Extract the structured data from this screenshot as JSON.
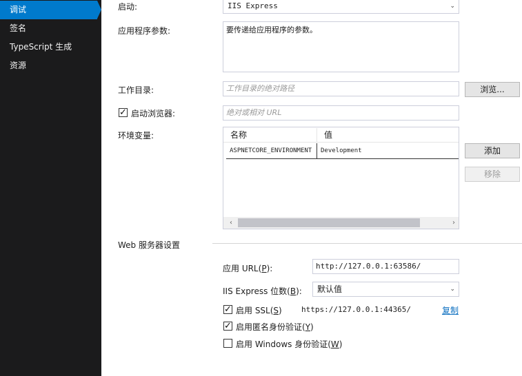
{
  "sidebar": {
    "items": [
      {
        "label": "调试"
      },
      {
        "label": "签名"
      },
      {
        "label": "TypeScript 生成"
      },
      {
        "label": "资源"
      }
    ]
  },
  "form": {
    "launch": {
      "label": "启动:",
      "value": "IIS Express"
    },
    "app_args": {
      "label": "应用程序参数:",
      "placeholder": "要传递给应用程序的参数。"
    },
    "working_dir": {
      "label": "工作目录:",
      "placeholder": "工作目录的绝对路径",
      "browse_label": "浏览..."
    },
    "launch_browser": {
      "label": "启动浏览器:",
      "checked": true,
      "placeholder": "绝对或相对 URL"
    },
    "env_vars": {
      "label": "环境变量:",
      "columns": [
        "名称",
        "值"
      ],
      "rows": [
        {
          "name": "ASPNETCORE_ENVIRONMENT",
          "value": "Development"
        }
      ],
      "add_label": "添加",
      "remove_label": "移除"
    }
  },
  "web_server": {
    "section_title": "Web 服务器设置",
    "app_url": {
      "label_prefix": "应用 URL(",
      "accel": "P",
      "label_suffix": "):",
      "value": "http://127.0.0.1:63586/"
    },
    "bitness": {
      "label_prefix": "IIS Express 位数(",
      "accel": "B",
      "label_suffix": "):",
      "value": "默认值"
    },
    "ssl": {
      "label_prefix": "启用 SSL(",
      "accel": "S",
      "label_suffix": ")",
      "checked": true,
      "url": "https://127.0.0.1:44365/",
      "copy_label": "复制"
    },
    "anon_auth": {
      "label_prefix": "启用匿名身份验证(",
      "accel": "Y",
      "label_suffix": ")",
      "checked": true
    },
    "windows_auth": {
      "label_prefix": "启用 Windows 身份验证(",
      "accel": "W",
      "label_suffix": ")",
      "checked": false
    }
  },
  "colors": {
    "accent": "#007acc",
    "sidebar_bg": "#1b1b1c",
    "link": "#0e70c0"
  }
}
